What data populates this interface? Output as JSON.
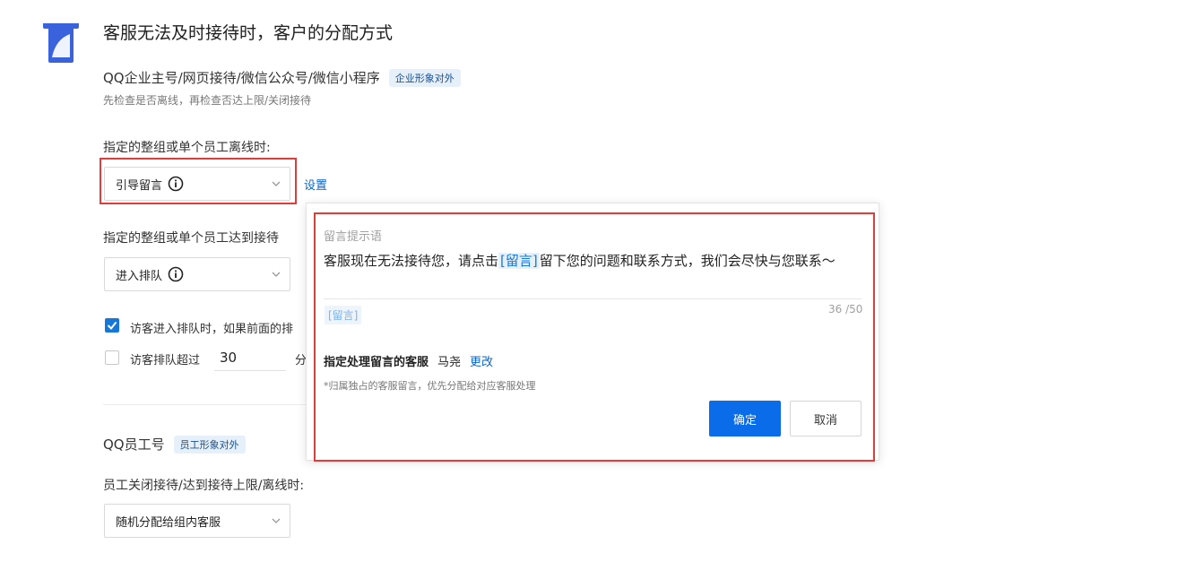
{
  "header": {
    "title": "客服无法及时接待时，客户的分配方式"
  },
  "section1": {
    "title": "QQ企业主号/网页接待/微信公众号/微信小程序",
    "tag": "企业形象对外",
    "hint": "先检查是否离线，再检查否达上限/关闭接待",
    "offline_label": "指定的整组或单个员工离线时:",
    "offline_select": "引导留言",
    "settings_link": "设置",
    "limit_label": "指定的整组或单个员工达到接待",
    "limit_select": "进入排队",
    "checkbox1_text": "访客进入排队时，如果前面的排",
    "checkbox1_checked": true,
    "checkbox2_text": "访客排队超过",
    "checkbox2_checked": false,
    "queue_value": "30",
    "queue_unit": "分"
  },
  "section2": {
    "title": "QQ员工号",
    "tag": "员工形象对外",
    "label": "员工关闭接待/达到接待上限/离线时:",
    "select": "随机分配给组内客服"
  },
  "popup": {
    "field_label": "留言提示语",
    "message_before": "客服现在无法接待您，请点击",
    "message_highlight": "[留言]",
    "message_after": "留下您的问题和联系方式，我们会尽快与您联系～",
    "token": "[留言]",
    "counter": "36 /50",
    "assign_label": "指定处理留言的客服",
    "assign_name": "马尧",
    "change_link": "更改",
    "note": "*归属独占的客服留言，优先分配给对应客服处理",
    "confirm": "确定",
    "cancel": "取消"
  },
  "colors": {
    "accent": "#0a6ce8",
    "highlight_frame": "#e23b3b",
    "tag_bg": "#e6f0fb"
  }
}
